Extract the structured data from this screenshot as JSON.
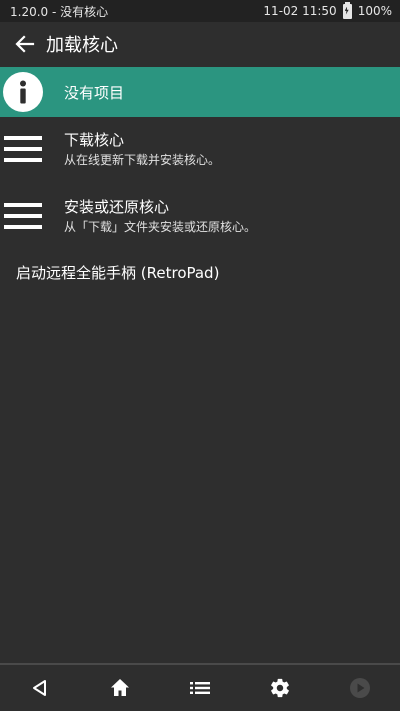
{
  "statusbar": {
    "left_text": "1.20.0 - 没有核心",
    "datetime": "11-02 11:50",
    "battery": "100%"
  },
  "header": {
    "title": "加载核心",
    "back_icon": "arrow-left-icon"
  },
  "notice": {
    "icon": "info-icon",
    "label": "没有项目"
  },
  "menu": {
    "items": [
      {
        "icon": "hamburger-icon",
        "title": "下载核心",
        "subtitle": "从在线更新下载并安装核心。"
      },
      {
        "icon": "hamburger-icon",
        "title": "安装或还原核心",
        "subtitle": "从「下载」文件夹安装或还原核心。"
      }
    ],
    "plain_item": "启动远程全能手柄 (RetroPad)"
  },
  "bottom_nav": {
    "buttons": [
      "back-triangle-icon",
      "home-icon",
      "list-icon",
      "gear-icon",
      "play-circle-icon"
    ]
  },
  "colors": {
    "background": "#2e2e2e",
    "statusbar": "#222222",
    "accent": "#2b9580",
    "text": "#ffffff"
  }
}
